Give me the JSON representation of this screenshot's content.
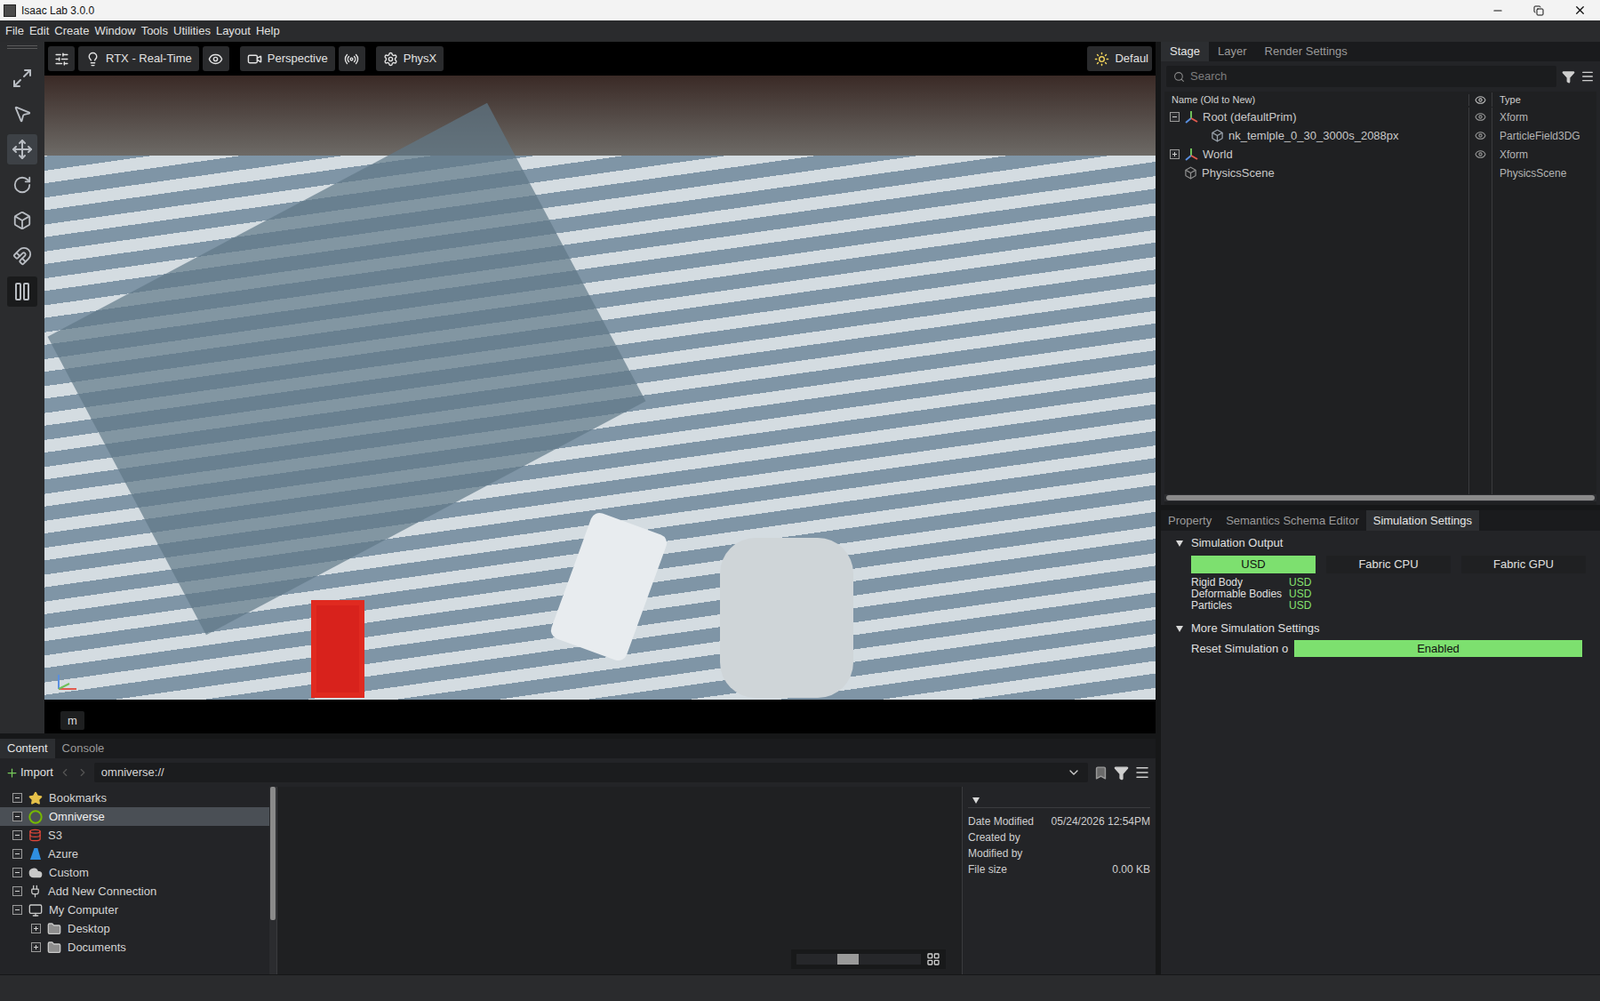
{
  "window": {
    "title": "Isaac Lab 3.0.0"
  },
  "menu": [
    "File",
    "Edit",
    "Create",
    "Window",
    "Tools",
    "Utilities",
    "Layout",
    "Help"
  ],
  "left_toolbar": [
    {
      "kind": "frame",
      "selected": false
    },
    {
      "kind": "select",
      "selected": false
    },
    {
      "kind": "move",
      "selected": true
    },
    {
      "kind": "rotate",
      "selected": false
    },
    {
      "kind": "scale",
      "selected": false
    },
    {
      "kind": "snap",
      "selected": false
    },
    {
      "kind": "pause",
      "selected": false
    }
  ],
  "viewport": {
    "renderer": "RTX - Real-Time",
    "camera": "Perspective",
    "physics": "PhysX",
    "lighting": "Defaul",
    "unit": "m"
  },
  "stage": {
    "tabs": [
      {
        "label": "Stage",
        "selected": true
      },
      {
        "label": "Layer",
        "selected": false
      },
      {
        "label": "Render Settings",
        "selected": false
      }
    ],
    "search": {
      "placeholder": "Search"
    },
    "columns": {
      "name": "Name (Old to New)",
      "type": "Type"
    },
    "rows": [
      {
        "name": "Root (defaultPrim)",
        "type": "Xform",
        "depth": 0,
        "kind": "xform",
        "expandable": true,
        "expanded": true,
        "visible": true
      },
      {
        "name": "nk_temlple_0_30_3000s_2088px",
        "type": "ParticleField3DG",
        "depth": 1,
        "kind": "particles",
        "expandable": false,
        "expanded": false,
        "visible": true
      },
      {
        "name": "World",
        "type": "Xform",
        "depth": 0,
        "kind": "xform",
        "expandable": true,
        "expanded": false,
        "visible": true
      },
      {
        "name": "PhysicsScene",
        "type": "PhysicsScene",
        "depth": 0,
        "kind": "scene",
        "expandable": false,
        "expanded": false,
        "visible": false
      }
    ]
  },
  "property": {
    "tabs": [
      {
        "label": "Property",
        "selected": false
      },
      {
        "label": "Semantics Schema Editor",
        "selected": false
      },
      {
        "label": "Simulation Settings",
        "selected": true
      }
    ]
  },
  "simulation_settings": {
    "output": {
      "title": "Simulation Output",
      "expanded": true,
      "modes": [
        {
          "label": "USD",
          "selected": true
        },
        {
          "label": "Fabric CPU",
          "selected": false
        },
        {
          "label": "Fabric GPU",
          "selected": false
        }
      ],
      "rows": [
        {
          "label": "Rigid Body",
          "value": "USD"
        },
        {
          "label": "Deformable Bodies",
          "value": "USD"
        },
        {
          "label": "Particles",
          "value": "USD"
        }
      ]
    },
    "more": {
      "title": "More Simulation Settings",
      "expanded": true,
      "reset": {
        "label": "Reset Simulation o",
        "value": "Enabled",
        "on": true
      }
    }
  },
  "content": {
    "tabs": [
      {
        "label": "Content",
        "selected": true
      },
      {
        "label": "Console",
        "selected": false
      }
    ],
    "import": "Import",
    "path": "omniverse://",
    "tree": [
      {
        "label": "Bookmarks",
        "kind": "bookmarks",
        "depth": 0,
        "expanded": true,
        "selected": false
      },
      {
        "label": "Omniverse",
        "kind": "omniverse",
        "depth": 0,
        "expanded": true,
        "selected": true
      },
      {
        "label": "S3",
        "kind": "s3",
        "depth": 0,
        "expanded": true,
        "selected": false
      },
      {
        "label": "Azure",
        "kind": "azure",
        "depth": 0,
        "expanded": true,
        "selected": false
      },
      {
        "label": "Custom",
        "kind": "cloud",
        "depth": 0,
        "expanded": true,
        "selected": false
      },
      {
        "label": "Add New Connection",
        "kind": "connection",
        "depth": 0,
        "expanded": true,
        "selected": false
      },
      {
        "label": "My Computer",
        "kind": "computer",
        "depth": 0,
        "expanded": true,
        "selected": false
      },
      {
        "label": "Desktop",
        "kind": "folder",
        "depth": 1,
        "expanded": false,
        "selected": false
      },
      {
        "label": "Documents",
        "kind": "folder",
        "depth": 1,
        "expanded": false,
        "selected": false
      }
    ],
    "details": [
      {
        "label": "Date Modified",
        "value": "05/24/2026 12:54PM"
      },
      {
        "label": "Created by",
        "value": ""
      },
      {
        "label": "Modified by",
        "value": ""
      },
      {
        "label": "File size",
        "value": "0.00 KB"
      }
    ],
    "zoom": {
      "level": 0.4
    }
  }
}
